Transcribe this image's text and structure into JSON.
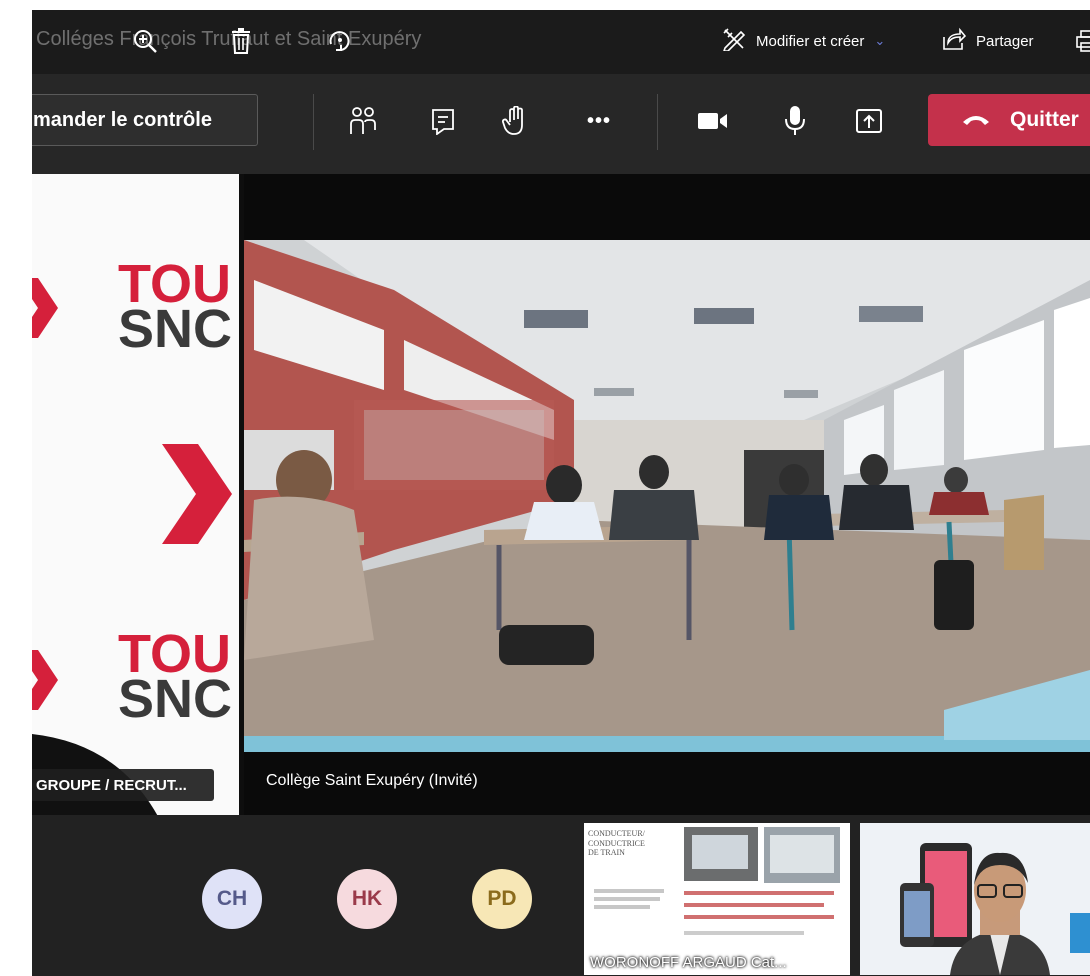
{
  "window": {
    "meeting_title": "Colléges François Truffaut et Saint Exupéry"
  },
  "titlebar": {
    "zoom_icon": "zoom-in-icon",
    "trash_icon": "trash-icon",
    "rotate_icon": "rotate-icon",
    "edit_label": "Modifier et créer",
    "edit_chevron": "⌄",
    "share_label": "Partager"
  },
  "controls": {
    "request_control_label": "mander le contrôle",
    "people_icon": "people-icon",
    "chat_icon": "chat-icon",
    "raise_hand_icon": "raise-hand-icon",
    "more_icon": "more-icon",
    "more_label": "•••",
    "camera_icon": "camera-icon",
    "mic_icon": "microphone-icon",
    "share_screen_icon": "share-screen-icon",
    "quit_label": "Quitter"
  },
  "participants_main": {
    "left_tile_label": "GROUPE / RECRUT...",
    "left_tile_brand_red": "TOU",
    "left_tile_brand_dark": "SNC",
    "main_tile_label": "Collège Saint Exupéry (Invité)"
  },
  "strip": {
    "avatars": [
      {
        "initials": "CH"
      },
      {
        "initials": "HK"
      },
      {
        "initials": "PD"
      }
    ],
    "slide_thumb_title": "CONDUCTEUR/\nCONDUCTRICE\nDE TRAIN",
    "slide_thumb_name": "WORONOFF ARGAUD Cat..."
  },
  "colors": {
    "quit_red": "#c4314b",
    "brand_red": "#d5203b",
    "accent_blue": "#6b7bd6"
  }
}
